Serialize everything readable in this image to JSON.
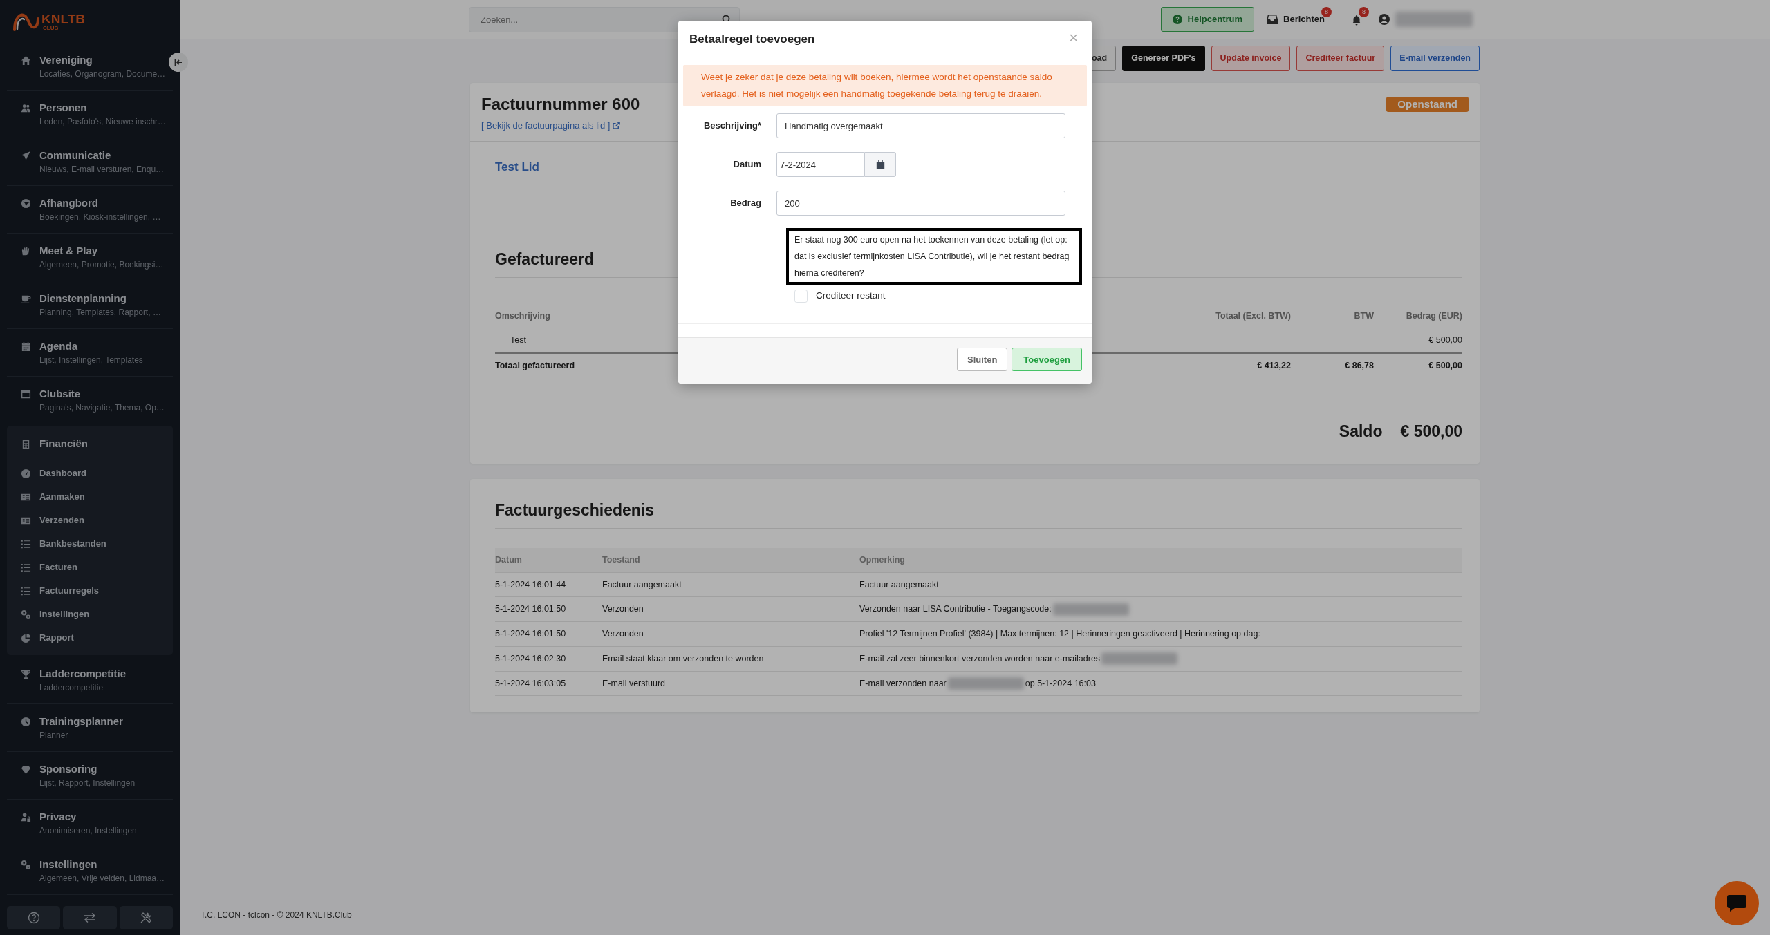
{
  "sidebar": {
    "logo": {
      "title": "KNLTB",
      "subtitle": "CLUB"
    },
    "items": [
      {
        "title": "Vereniging",
        "subtitle": "Locaties, Organogram, Docume…",
        "expanded": false
      },
      {
        "title": "Personen",
        "subtitle": "Leden, Pasfoto's, Nieuwe inschr…",
        "expanded": false
      },
      {
        "title": "Communicatie",
        "subtitle": "Nieuws, E-mail versturen, Enqu…",
        "expanded": false
      },
      {
        "title": "Afhangbord",
        "subtitle": "Boekingen, Kiosk-instellingen, …",
        "expanded": false
      },
      {
        "title": "Meet & Play",
        "subtitle": "Algemeen, Promotie, Boekingsi…",
        "expanded": false
      },
      {
        "title": "Dienstenplanning",
        "subtitle": "Planning, Templates, Rapport, …",
        "expanded": false
      },
      {
        "title": "Agenda",
        "subtitle": "Lijst, Instellingen, Templates",
        "expanded": false
      },
      {
        "title": "Clubsite",
        "subtitle": "Pagina's, Navigatie, Thema, Op…",
        "expanded": false
      },
      {
        "title": "Financiën",
        "expanded": true,
        "children": [
          {
            "label": "Dashboard"
          },
          {
            "label": "Aanmaken"
          },
          {
            "label": "Verzenden"
          },
          {
            "label": "Bankbestanden"
          },
          {
            "label": "Facturen"
          },
          {
            "label": "Factuurregels"
          },
          {
            "label": "Instellingen"
          },
          {
            "label": "Rapport"
          }
        ]
      },
      {
        "title": "Laddercompetitie",
        "subtitle": "Laddercompetitie",
        "expanded": false
      },
      {
        "title": "Trainingsplanner",
        "subtitle": "Planner",
        "expanded": false
      },
      {
        "title": "Sponsoring",
        "subtitle": "Lijst, Rapport, Instellingen",
        "expanded": false
      },
      {
        "title": "Privacy",
        "subtitle": "Anonimiseren, Instellingen",
        "expanded": false
      },
      {
        "title": "Instellingen",
        "subtitle": "Algemeen, Vrije velden, Lidmaa…",
        "expanded": false
      }
    ]
  },
  "topbar": {
    "search": {
      "placeholder": "Zoeken..."
    },
    "help_button": "Helpcentrum",
    "messages": {
      "label": "Berichten",
      "count": "8"
    },
    "notifications": {
      "count": "8"
    },
    "user": {
      "kind": "redacted"
    }
  },
  "actions": [
    {
      "label": "oad",
      "kind": "secondary"
    },
    {
      "label": "Genereer PDF's",
      "kind": "dark"
    },
    {
      "label": "Update invoice",
      "kind": "danger"
    },
    {
      "label": "Crediteer factuur",
      "kind": "danger"
    },
    {
      "label": "E-mail verzenden",
      "kind": "primary"
    }
  ],
  "invoice": {
    "title": "Factuurnummer 600",
    "link": "[ Bekijk de factuurpagina als lid ]",
    "status": "Openstaand",
    "member": "Test Lid",
    "section_title": "Gefactureerd",
    "columns": [
      "Omschrijving",
      "Totaal (Excl. BTW)",
      "BTW",
      "Bedrag (EUR)"
    ],
    "rows": [
      {
        "omschrijving": "Test",
        "bedrag": "€ 500,00"
      }
    ],
    "total": {
      "label": "Totaal gefactureerd",
      "excl": "€ 413,22",
      "btw": "€ 86,78",
      "bedrag": "€ 500,00"
    },
    "saldo_label": "Saldo",
    "saldo": "€ 500,00"
  },
  "history": {
    "title": "Factuurgeschiedenis",
    "columns": [
      "Datum",
      "Toestand",
      "Opmerking"
    ],
    "rows": [
      {
        "datum": "5-1-2024 16:01:44",
        "toestand": "Factuur aangemaakt",
        "opmerking": [
          {
            "kind": "text",
            "text": "Factuur aangemaakt"
          }
        ]
      },
      {
        "datum": "5-1-2024 16:01:50",
        "toestand": "Verzonden",
        "opmerking": [
          {
            "kind": "text",
            "text": "Verzonden naar LISA Contributie - Toegangscode:"
          },
          {
            "kind": "redacted"
          }
        ]
      },
      {
        "datum": "5-1-2024 16:01:50",
        "toestand": "Verzonden",
        "opmerking": [
          {
            "kind": "text",
            "text": "Profiel '12 Termijnen Profiel' (3984) | Max termijnen: 12 | Herinneringen geactiveerd | Herinnering op dag:"
          }
        ]
      },
      {
        "datum": "5-1-2024 16:02:30",
        "toestand": "Email staat klaar om verzonden te worden",
        "opmerking": [
          {
            "kind": "text",
            "text": "E-mail zal zeer binnenkort verzonden worden naar e-mailadres"
          },
          {
            "kind": "redacted"
          }
        ]
      },
      {
        "datum": "5-1-2024 16:03:05",
        "toestand": "E-mail verstuurd",
        "opmerking": [
          {
            "kind": "text",
            "text": "E-mail verzonden naar"
          },
          {
            "kind": "redacted"
          },
          {
            "kind": "text",
            "text": "op 5-1-2024 16:03"
          }
        ]
      }
    ]
  },
  "footer": "T.C. LCON - tclcon - © 2024 KNLTB.Club",
  "modal": {
    "title": "Betaalregel toevoegen",
    "close": "×",
    "alert": "Weet je zeker dat je deze betaling wilt boeken, hiermee wordt het openstaande saldo verlaagd. Het is niet mogelijk een handmatig toegekende betaling terug te draaien.",
    "fields": [
      {
        "label": "Beschrijving*",
        "value": "Handmatig overgemaakt",
        "kind": "text"
      },
      {
        "label": "Datum",
        "value": "7-2-2024",
        "kind": "date"
      },
      {
        "label": "Bedrag",
        "value": "200",
        "kind": "text"
      }
    ],
    "note": "Er staat nog 300 euro open na het toekennen van deze betaling (let op: dat is exclusief termijnkosten LISA Contributie), wil je het restant bedrag hierna crediteren?",
    "checkbox": {
      "label": "Crediteer restant",
      "checked": false
    },
    "buttons": [
      {
        "label": "Sluiten",
        "kind": "secondary"
      },
      {
        "label": "Toevoegen",
        "kind": "success"
      }
    ]
  }
}
